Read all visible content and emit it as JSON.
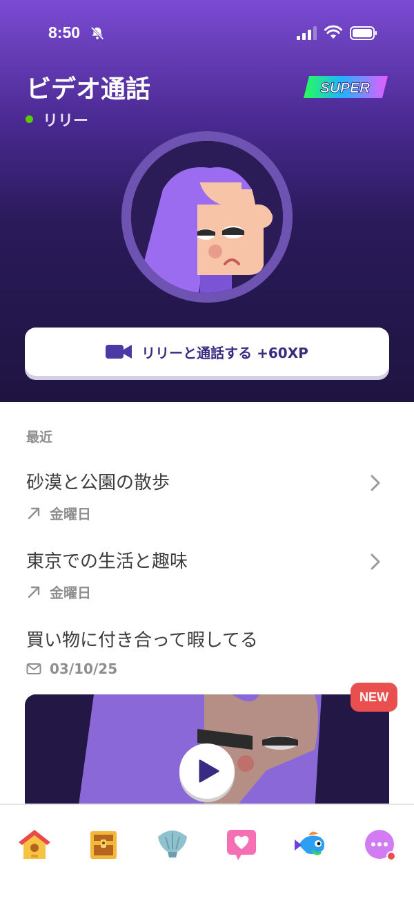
{
  "status_bar": {
    "time": "8:50",
    "icons": [
      "bell-slash-icon",
      "cellular-signal-icon",
      "wifi-icon",
      "battery-icon"
    ]
  },
  "header": {
    "title": "ビデオ通話",
    "contact_name": "リリー",
    "online_status_color": "#58cc02",
    "super_badge": "SUPER"
  },
  "call_button": {
    "label": "リリーと通話する +60XP",
    "icon": "video-camera-icon"
  },
  "recents": {
    "section_label": "最近",
    "items": [
      {
        "title": "砂漠と公園の散歩",
        "meta": "金曜日",
        "meta_icon": "outgoing-arrow-icon",
        "has_chevron": true
      },
      {
        "title": "東京での生活と趣味",
        "meta": "金曜日",
        "meta_icon": "outgoing-arrow-icon",
        "has_chevron": true
      },
      {
        "title": "買い物に付き合って暇してる",
        "meta": "03/10/25",
        "meta_icon": "envelope-icon",
        "has_chevron": false
      }
    ]
  },
  "video_preview": {
    "badge": "NEW",
    "play_icon": "play-icon"
  },
  "tabbar": {
    "items": [
      {
        "name": "home",
        "icon": "birdhouse-icon",
        "active": true
      },
      {
        "name": "chest",
        "icon": "treasure-chest-icon",
        "active": false
      },
      {
        "name": "shell",
        "icon": "shell-icon",
        "active": false
      },
      {
        "name": "video-call",
        "icon": "heart-chat-icon",
        "active": false
      },
      {
        "name": "practice",
        "icon": "fish-icon",
        "active": false
      },
      {
        "name": "more",
        "icon": "more-dots-icon",
        "active": false,
        "has_notification": true
      }
    ]
  },
  "colors": {
    "brand_purple": "#7b4bd3",
    "dark_purple": "#1e1440",
    "call_label": "#3b2a82",
    "new_badge": "#ea4f4f",
    "text_primary": "#3c3c3c",
    "text_secondary": "#8e8e8e"
  }
}
